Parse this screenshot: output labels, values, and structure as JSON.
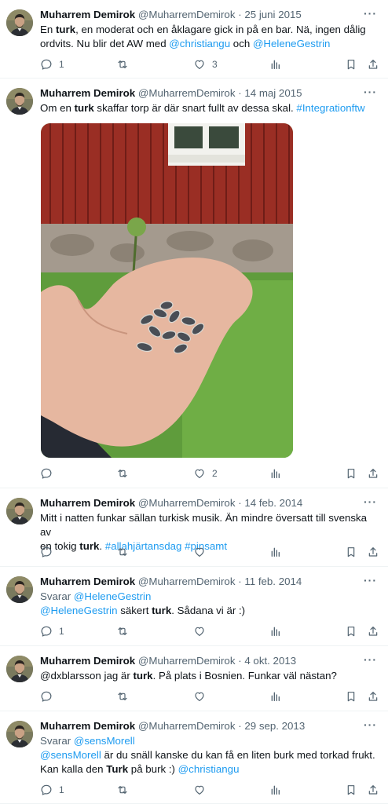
{
  "icons": {
    "reply": "speech-bubble-icon",
    "retweet": "retweet-arrows-icon",
    "like": "heart-icon",
    "views": "bar-chart-icon",
    "bookmark": "bookmark-icon",
    "share": "share-upload-icon",
    "more": "more-dots-icon"
  },
  "colors": {
    "link": "#1d9bf0",
    "muted": "#536471",
    "text": "#0f1419"
  },
  "tweets": [
    {
      "name": "Muharrem Demirok",
      "handle": "@MuharremDemirok",
      "sep": "·",
      "date": "25 juni 2015",
      "more": "···",
      "replies": "1",
      "retweets": "",
      "likes": "3",
      "text": {
        "l1a": "En ",
        "l1b": "turk",
        "l1c": ", en moderat och en åklagare gick in på en bar. Nä, ingen dålig",
        "l2a": "ordvits. Nu blir det AW med ",
        "l2b": "@christiangu",
        "l2c": " och ",
        "l2d": "@HeleneGestrin"
      }
    },
    {
      "name": "Muharrem Demirok",
      "handle": "@MuharremDemirok",
      "sep": "·",
      "date": "14 maj 2015",
      "more": "···",
      "replies": "",
      "retweets": "",
      "likes": "2",
      "text": {
        "l1a": "Om en ",
        "l1b": "turk",
        "l1c": " skaffar torp är där snart fullt av dessa skal. ",
        "l1d": "#Integrationftw"
      }
    },
    {
      "name": "Muharrem Demirok",
      "handle": "@MuharremDemirok",
      "sep": "·",
      "date": "14 feb. 2014",
      "more": "···",
      "replies": "",
      "retweets": "",
      "likes": "",
      "text": {
        "l1a": "Mitt i natten funkar sällan turkisk musik. Än mindre översatt till svenska av",
        "l2a": "en tokig ",
        "l2b": "turk",
        "l2c": ". ",
        "l2d": "#allahjärtansdag",
        "l2e": " ",
        "l2f": "#pinsamt"
      }
    },
    {
      "name": "Muharrem Demirok",
      "handle": "@MuharremDemirok",
      "sep": "·",
      "date": "11 feb. 2014",
      "more": "···",
      "replies": "1",
      "retweets": "",
      "likes": "",
      "reply_label": "Svarar ",
      "reply_handle": "@HeleneGestrin",
      "text": {
        "l1a": "@HeleneGestrin",
        "l1b": " säkert ",
        "l1c": "turk",
        "l1d": ". Sådana vi är :)"
      }
    },
    {
      "name": "Muharrem Demirok",
      "handle": "@MuharremDemirok",
      "sep": "·",
      "date": "4 okt. 2013",
      "more": "···",
      "replies": "",
      "retweets": "",
      "likes": "",
      "text": {
        "l1a": "@dxblarsson jag är ",
        "l1b": "turk",
        "l1c": ". På plats i Bosnien. Funkar väl nästan?"
      }
    },
    {
      "name": "Muharrem Demirok",
      "handle": "@MuharremDemirok",
      "sep": "·",
      "date": "29 sep. 2013",
      "more": "···",
      "replies": "1",
      "retweets": "",
      "likes": "",
      "reply_label": "Svarar ",
      "reply_handle": "@sensMorell",
      "text": {
        "l1a": "@sensMorell",
        "l1b": " är du snäll kanske du kan få en liten burk med torkad frukt.",
        "l2a": "Kan kalla den ",
        "l2b": "Turk",
        "l2c": " på burk :) ",
        "l2d": "@christiangu"
      }
    }
  ]
}
